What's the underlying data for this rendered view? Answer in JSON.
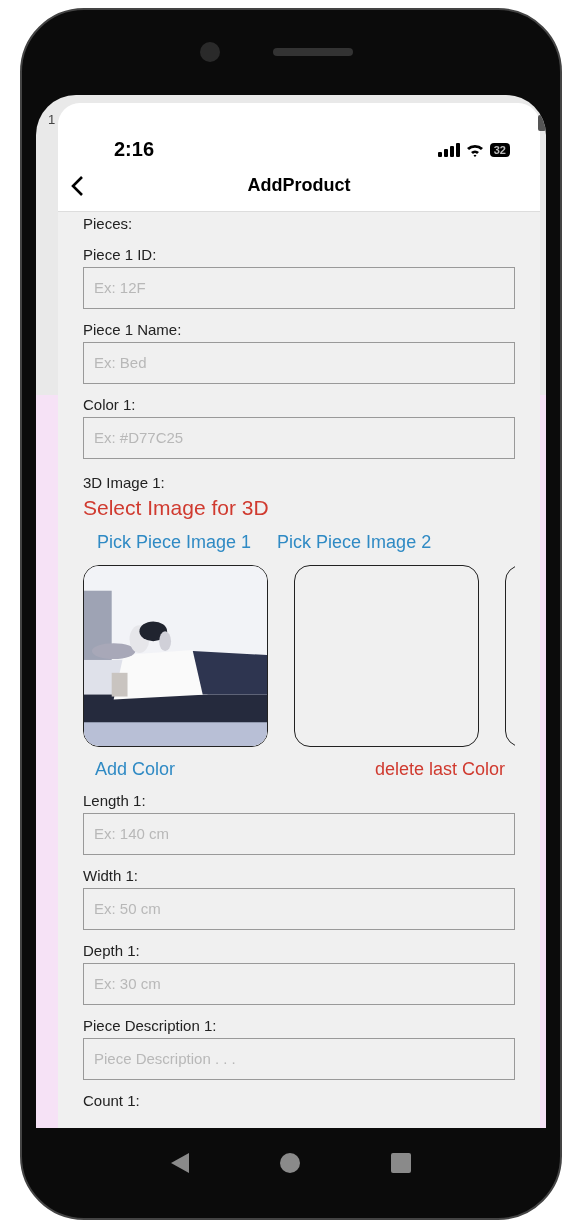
{
  "background_app": {
    "status_text": "1"
  },
  "status_bar": {
    "time": "2:16",
    "battery": "32"
  },
  "header": {
    "title": "AddProduct"
  },
  "section_label": "Pieces:",
  "fields_top": [
    {
      "label": "Piece 1 ID:",
      "placeholder": "Ex: 12F"
    },
    {
      "label": "Piece 1 Name:",
      "placeholder": "Ex: Bed"
    },
    {
      "label": "Color 1:",
      "placeholder": "Ex: #D77C25"
    }
  ],
  "image_section": {
    "label": "3D Image 1:",
    "select_link": "Select Image for 3D",
    "pick_buttons": [
      "Pick Piece Image 1",
      "Pick Piece Image 2"
    ],
    "slots": [
      {
        "kind": "picture"
      },
      {
        "kind": "empty"
      },
      {
        "kind": "empty"
      }
    ],
    "add_button": "Add Color",
    "delete_button": "delete last Color"
  },
  "fields_bottom": [
    {
      "label": "Length 1:",
      "placeholder": "Ex: 140 cm"
    },
    {
      "label": "Width 1:",
      "placeholder": "Ex: 50 cm"
    },
    {
      "label": "Depth 1:",
      "placeholder": "Ex: 30 cm"
    },
    {
      "label": "Piece Description 1:",
      "placeholder": "Piece Description . . ."
    }
  ],
  "trailing_label": "Count 1:"
}
